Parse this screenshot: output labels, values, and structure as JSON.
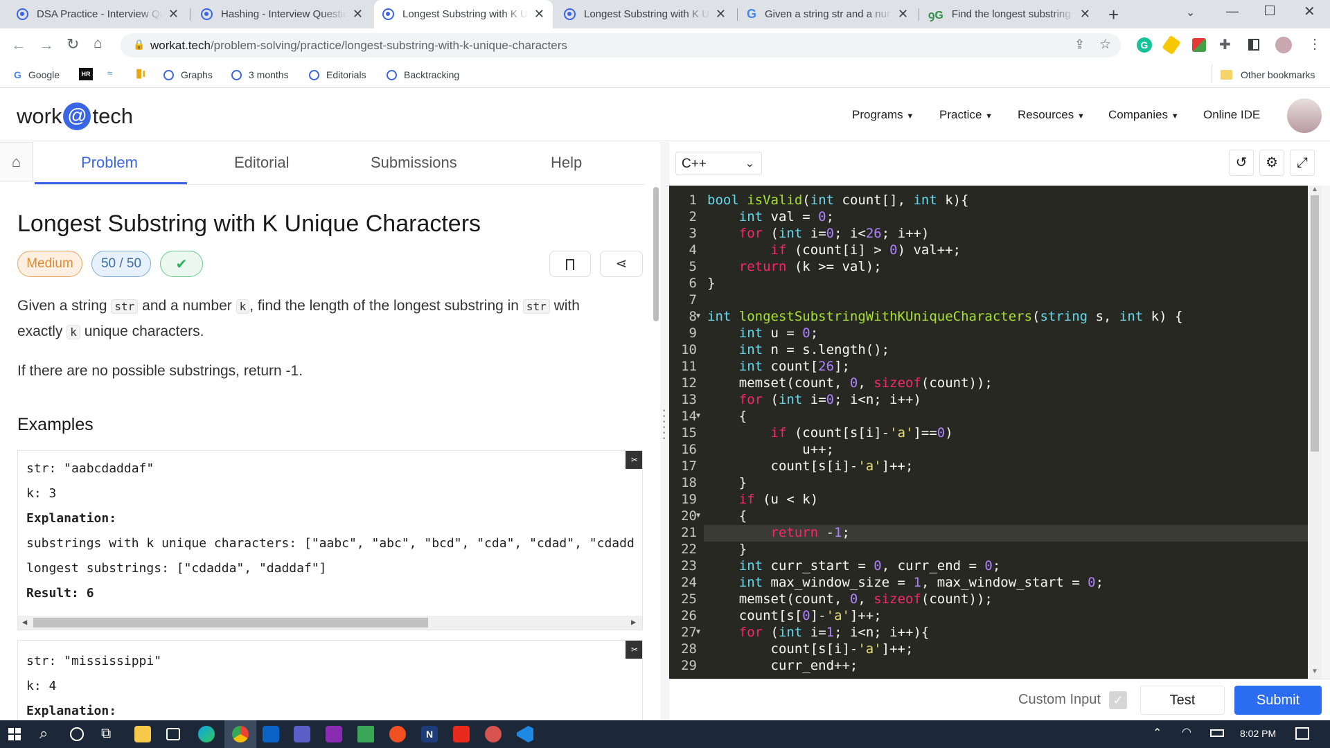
{
  "browser": {
    "tabs": [
      {
        "title": "DSA Practice - Interview Qu",
        "active": false
      },
      {
        "title": "Hashing - Interview Questic",
        "active": false
      },
      {
        "title": "Longest Substring with K U",
        "active": true
      },
      {
        "title": "Longest Substring with K U",
        "active": false
      },
      {
        "title": "Given a string str and a nur",
        "active": false
      },
      {
        "title": "Find the longest substring",
        "active": false
      }
    ],
    "url_host": "workat.tech",
    "url_path": "/problem-solving/practice/longest-substring-with-k-unique-characters",
    "bookmarks": [
      "Google",
      "Graphs",
      "3 months",
      "Editorials",
      "Backtracking"
    ],
    "other_bookmarks": "Other bookmarks"
  },
  "site": {
    "logo_left": "work",
    "logo_at": "@",
    "logo_right": "tech",
    "nav": [
      "Programs",
      "Practice",
      "Resources",
      "Companies",
      "Online IDE"
    ]
  },
  "problem": {
    "tabs": [
      "Problem",
      "Editorial",
      "Submissions",
      "Help"
    ],
    "title": "Longest Substring with K Unique Characters",
    "difficulty": "Medium",
    "score": "50 / 50",
    "desc_1": "Given a string",
    "desc_code_str": "str",
    "desc_2": "and a number",
    "desc_code_k": "k",
    "desc_3": ", find the length of the longest substring in",
    "desc_4": "with",
    "desc_5": "exactly",
    "desc_6": "unique characters.",
    "desc_para2": "If there are no possible substrings, return -1.",
    "examples_heading": "Examples",
    "example1": [
      "str: \"aabcdaddaf\"",
      "k: 3",
      "Explanation:",
      "substrings with k unique characters: [\"aabc\", \"abc\", \"bcd\", \"cda\", \"cdad\", \"cdadd",
      "longest substrings: [\"cdadda\", \"daddaf\"]",
      "Result: 6"
    ],
    "example2": [
      "str: \"mississippi\"",
      "k: 4",
      "Explanation:"
    ]
  },
  "editor": {
    "language": "C++",
    "custom_input_label": "Custom Input",
    "test_label": "Test",
    "submit_label": "Submit",
    "lines": [
      "bool isValid(int count[], int k){",
      "    int val = 0;",
      "    for (int i=0; i<26; i++)",
      "        if (count[i] > 0) val++;",
      "    return (k >= val);",
      "}",
      "",
      "int longestSubstringWithKUniqueCharacters(string s, int k) {",
      "    int u = 0;",
      "    int n = s.length();",
      "    int count[26];",
      "    memset(count, 0, sizeof(count));",
      "    for (int i=0; i<n; i++)",
      "    {",
      "        if (count[s[i]-'a']==0)",
      "            u++;",
      "        count[s[i]-'a']++;",
      "    }",
      "    if (u < k)",
      "    {",
      "        return -1;",
      "    }",
      "    int curr_start = 0, curr_end = 0;",
      "    int max_window_size = 1, max_window_start = 0;",
      "    memset(count, 0, sizeof(count));",
      "    count[s[0]-'a']++;",
      "    for (int i=1; i<n; i++){",
      "        count[s[i]-'a']++;",
      "        curr_end++;"
    ],
    "fold_lines": [
      8,
      14,
      20,
      27
    ],
    "active_line": 21
  },
  "taskbar": {
    "time": "8:02 PM"
  }
}
